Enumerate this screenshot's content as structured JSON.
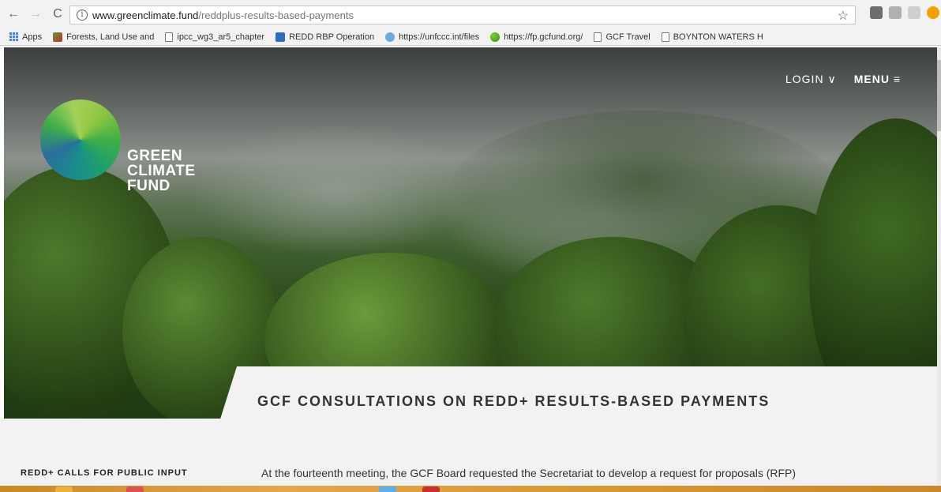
{
  "browser": {
    "url_host": "www.greenclimate.fund",
    "url_path": "/reddplus-results-based-payments",
    "nav": {
      "back": "←",
      "forward": "→",
      "reload": "C"
    }
  },
  "bookmarks": [
    {
      "label": "Apps",
      "icon": "apps-icon"
    },
    {
      "label": "Forests, Land Use and",
      "icon": "forest-icon"
    },
    {
      "label": "ipcc_wg3_ar5_chapter",
      "icon": "document-icon"
    },
    {
      "label": "REDD RBP Operation",
      "icon": "sharepoint-icon"
    },
    {
      "label": "https://unfccc.int/files",
      "icon": "unfccc-icon"
    },
    {
      "label": "https://fp.gcfund.org/",
      "icon": "globe-icon"
    },
    {
      "label": "GCF Travel",
      "icon": "document-icon"
    },
    {
      "label": "BOYNTON WATERS H",
      "icon": "document-icon"
    }
  ],
  "site": {
    "logo_lines": [
      "GREEN",
      "CLIMATE",
      "FUND"
    ],
    "login_label": "LOGIN",
    "menu_label": "MENU",
    "page_title": "GCF CONSULTATIONS ON REDD+ RESULTS-BASED PAYMENTS",
    "side_heading": "REDD+ CALLS FOR PUBLIC INPUT",
    "intro_text": "At the fourteenth meeting, the GCF Board requested the Secretariat to develop a request for proposals (RFP)"
  },
  "colors": {
    "logo_green": "#3fae49",
    "logo_teal": "#1a8a8f",
    "banner_bg": "#f2f2f2"
  }
}
